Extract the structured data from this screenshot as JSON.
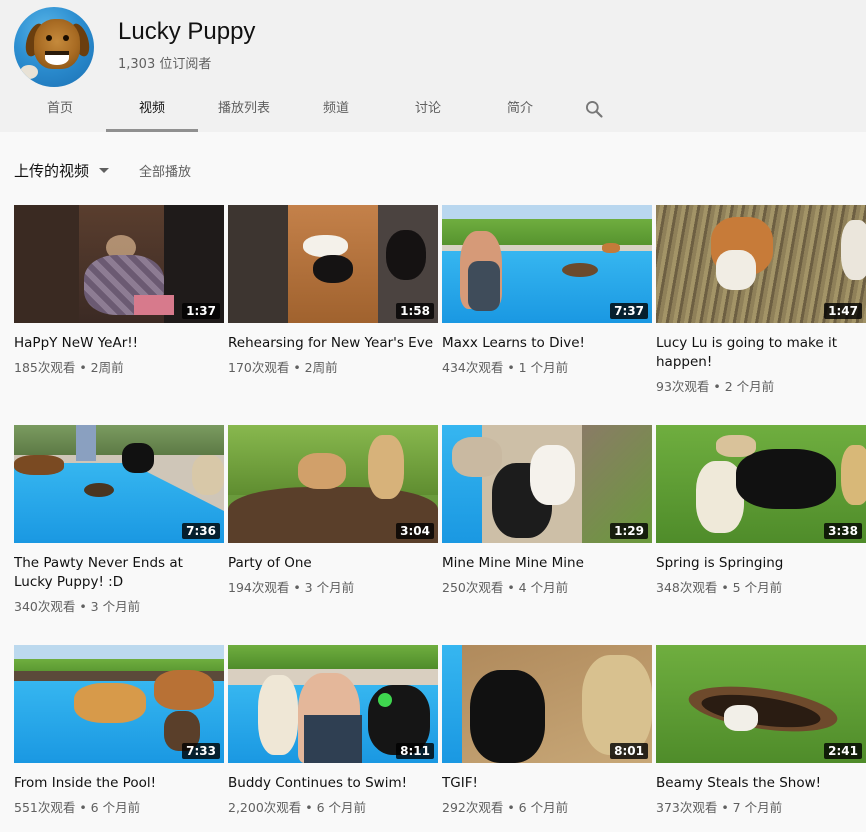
{
  "channel": {
    "name": "Lucky Puppy",
    "subscribers": "1,303 位订阅者"
  },
  "tabs": [
    {
      "label": "首页",
      "active": false
    },
    {
      "label": "视频",
      "active": true
    },
    {
      "label": "播放列表",
      "active": false
    },
    {
      "label": "频道",
      "active": false
    },
    {
      "label": "讨论",
      "active": false
    },
    {
      "label": "简介",
      "active": false
    }
  ],
  "search_icon": "search-icon",
  "section": {
    "title": "上传的视频",
    "play_all": "全部播放"
  },
  "videos": [
    {
      "title": "HaPpY NeW YeAr!!",
      "meta": "185次观看 • 2周前",
      "duration": "1:37"
    },
    {
      "title": "Rehearsing for New Year's Eve",
      "meta": "170次观看 • 2周前",
      "duration": "1:58"
    },
    {
      "title": "Maxx Learns to Dive!",
      "meta": "434次观看 • 1 个月前",
      "duration": "7:37"
    },
    {
      "title": "Lucy Lu is going to make it happen!",
      "meta": "93次观看 • 2 个月前",
      "duration": "1:47"
    },
    {
      "title": "The Pawty Never Ends at Lucky Puppy! :D",
      "meta": "340次观看 • 3 个月前",
      "duration": "7:36"
    },
    {
      "title": "Party of One",
      "meta": "194次观看 • 3 个月前",
      "duration": "3:04"
    },
    {
      "title": "Mine Mine Mine Mine",
      "meta": "250次观看 • 4 个月前",
      "duration": "1:29"
    },
    {
      "title": "Spring is Springing",
      "meta": "348次观看 • 5 个月前",
      "duration": "3:38"
    },
    {
      "title": "From Inside the Pool!",
      "meta": "551次观看 • 6 个月前",
      "duration": "7:33"
    },
    {
      "title": "Buddy Continues to Swim!",
      "meta": "2,200次观看 • 6 个月前",
      "duration": "8:11"
    },
    {
      "title": "TGIF!",
      "meta": "292次观看 • 6 个月前",
      "duration": "8:01"
    },
    {
      "title": "Beamy Steals the Show!",
      "meta": "373次观看 • 7 个月前",
      "duration": "2:41"
    }
  ]
}
